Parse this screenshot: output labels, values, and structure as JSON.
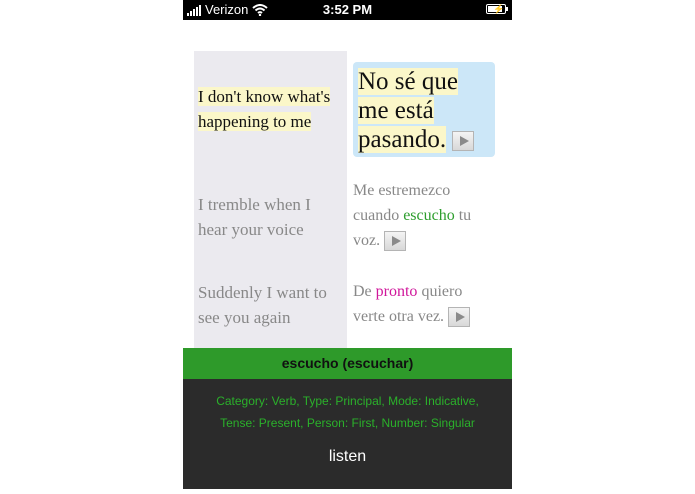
{
  "status": {
    "carrier": "Verizon",
    "time": "3:52 PM",
    "battery_level": 0.9
  },
  "lines": [
    {
      "english": "I don't know what's happening to me",
      "active": true
    },
    {
      "english": "I tremble when I hear your voice",
      "active": false
    },
    {
      "english": "Suddenly I want to see you again",
      "active": false
    }
  ],
  "spanish": {
    "line1": "No sé que me está pasando.",
    "line2_pre": "Me estremezco cuando",
    "line2_word": "escucho",
    "line2_mid": "tu",
    "line2_post": "voz.",
    "line3_pre": "De",
    "line3_word": "pronto",
    "line3_post": "quiero verte otra vez."
  },
  "word_colors": {
    "escucho": "#2e9e2e",
    "pronto": "#d0179b"
  },
  "popup": {
    "title": "escucho (escuchar)",
    "info_line1": "Category: Verb, Type: Principal, Mode: Indicative,",
    "info_line2": "Tense: Present, Person: First, Number: Singular",
    "listen": "listen"
  },
  "icons": [
    "signal-bars-icon",
    "wifi-icon",
    "battery-icon",
    "play-icon"
  ]
}
